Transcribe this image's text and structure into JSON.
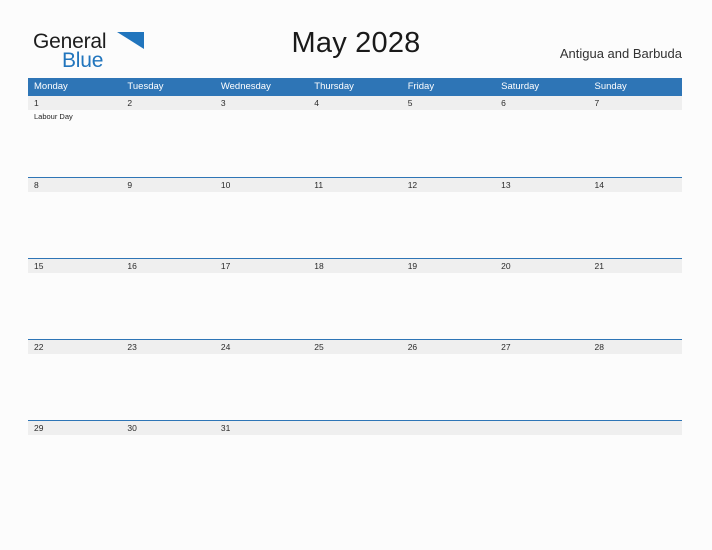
{
  "brand": {
    "name_part1": "General",
    "name_part2": "Blue",
    "flag_icon": "blue-triangle-flag",
    "color_dark": "#1d1d1d",
    "color_blue": "#2175bd"
  },
  "header": {
    "title": "May 2028",
    "country": "Antigua and Barbuda"
  },
  "theme": {
    "header_blue": "#2e75b6",
    "date_band_gray": "#efefef",
    "page_background": "#fcfcfc",
    "separator_blue": "#2e75b6"
  },
  "calendar": {
    "month": "May",
    "year": "2028",
    "weekday_headers": [
      "Monday",
      "Tuesday",
      "Wednesday",
      "Thursday",
      "Friday",
      "Saturday",
      "Sunday"
    ],
    "weeks": [
      {
        "days": [
          {
            "num": "1",
            "events": [
              "Labour Day"
            ]
          },
          {
            "num": "2",
            "events": []
          },
          {
            "num": "3",
            "events": []
          },
          {
            "num": "4",
            "events": []
          },
          {
            "num": "5",
            "events": []
          },
          {
            "num": "6",
            "events": []
          },
          {
            "num": "7",
            "events": []
          }
        ]
      },
      {
        "days": [
          {
            "num": "8",
            "events": []
          },
          {
            "num": "9",
            "events": []
          },
          {
            "num": "10",
            "events": []
          },
          {
            "num": "11",
            "events": []
          },
          {
            "num": "12",
            "events": []
          },
          {
            "num": "13",
            "events": []
          },
          {
            "num": "14",
            "events": []
          }
        ]
      },
      {
        "days": [
          {
            "num": "15",
            "events": []
          },
          {
            "num": "16",
            "events": []
          },
          {
            "num": "17",
            "events": []
          },
          {
            "num": "18",
            "events": []
          },
          {
            "num": "19",
            "events": []
          },
          {
            "num": "20",
            "events": []
          },
          {
            "num": "21",
            "events": []
          }
        ]
      },
      {
        "days": [
          {
            "num": "22",
            "events": []
          },
          {
            "num": "23",
            "events": []
          },
          {
            "num": "24",
            "events": []
          },
          {
            "num": "25",
            "events": []
          },
          {
            "num": "26",
            "events": []
          },
          {
            "num": "27",
            "events": []
          },
          {
            "num": "28",
            "events": []
          }
        ]
      },
      {
        "days": [
          {
            "num": "29",
            "events": []
          },
          {
            "num": "30",
            "events": []
          },
          {
            "num": "31",
            "events": []
          },
          {
            "num": "",
            "events": []
          },
          {
            "num": "",
            "events": []
          },
          {
            "num": "",
            "events": []
          },
          {
            "num": "",
            "events": []
          }
        ]
      }
    ]
  }
}
